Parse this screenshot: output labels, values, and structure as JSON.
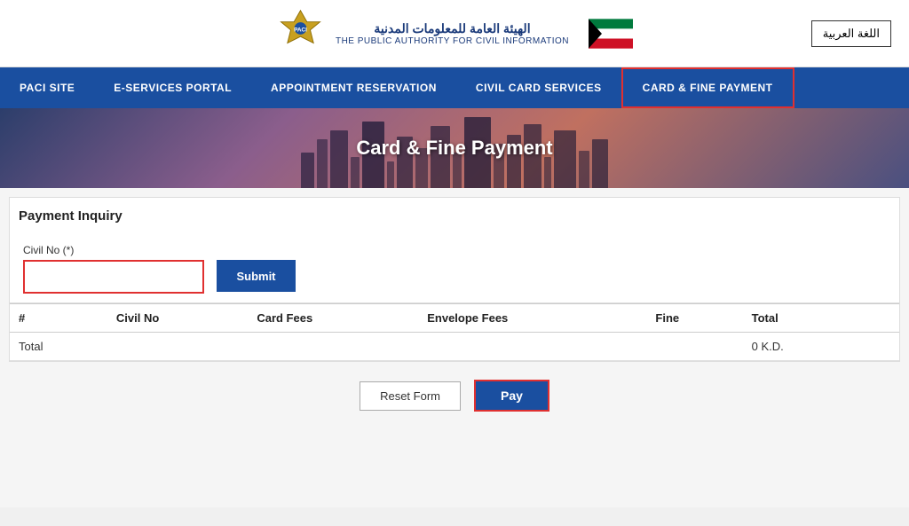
{
  "header": {
    "org_name_arabic": "الهيئة العامة للمعلومات المدنية",
    "org_name_english": "THE PUBLIC AUTHORITY FOR CIVIL INFORMATION",
    "lang_btn": "اللغة العربية"
  },
  "nav": {
    "items": [
      {
        "id": "paci-site",
        "label": "PACI SITE",
        "active": false
      },
      {
        "id": "e-services",
        "label": "E-SERVICES PORTAL",
        "active": false
      },
      {
        "id": "appointment",
        "label": "APPOINTMENT RESERVATION",
        "active": false
      },
      {
        "id": "civil-card",
        "label": "CIVIL CARD SERVICES",
        "active": false
      },
      {
        "id": "card-fine",
        "label": "CARD & FINE PAYMENT",
        "active": true
      }
    ]
  },
  "hero": {
    "title": "Card & Fine Payment"
  },
  "section": {
    "title": "Payment Inquiry"
  },
  "form": {
    "civil_no_label": "Civil No (*)",
    "civil_no_placeholder": "",
    "submit_label": "Submit"
  },
  "table": {
    "columns": [
      "#",
      "Civil No",
      "Card Fees",
      "Envelope Fees",
      "Fine",
      "Total"
    ],
    "rows": [],
    "total_row": {
      "label": "Total",
      "value": "0",
      "currency": "K.D."
    }
  },
  "buttons": {
    "reset_label": "Reset Form",
    "pay_label": "Pay"
  }
}
